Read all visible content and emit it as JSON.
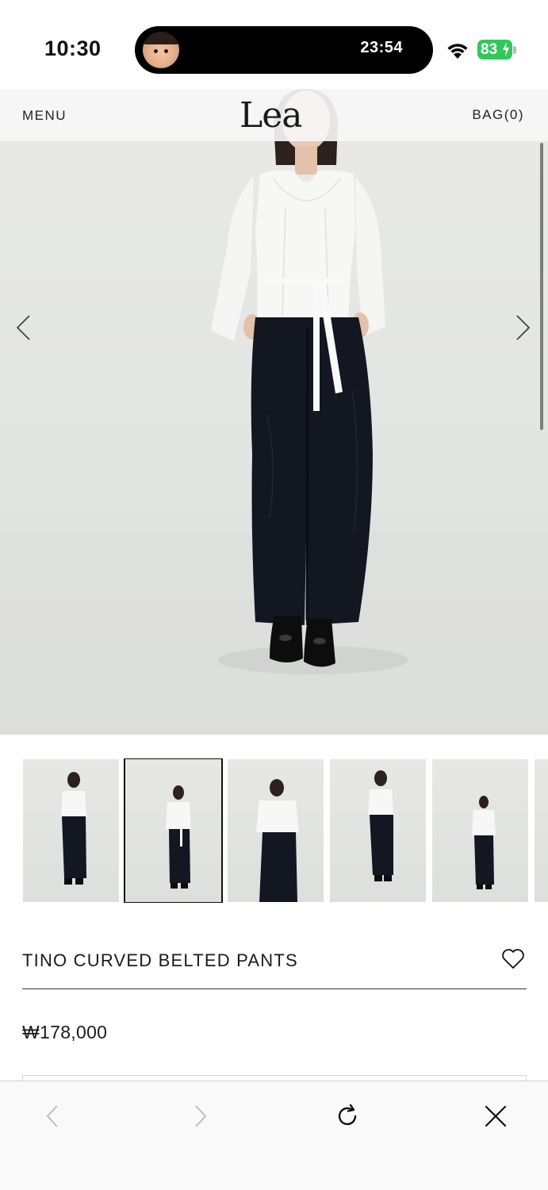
{
  "status_bar": {
    "time": "10:30",
    "live_activity_timer": "23:54",
    "battery_level": "83",
    "battery_color": "#33c759"
  },
  "header": {
    "menu_label": "MENU",
    "brand": "Lea",
    "bag_label": "BAG(0)"
  },
  "gallery": {
    "thumbnail_count": 6,
    "selected_index": 1,
    "prev_icon": "chevron-left-icon",
    "next_icon": "chevron-right-icon"
  },
  "product": {
    "name": "TINO CURVED BELTED PANTS",
    "price": "₩178,000",
    "wishlist_icon": "heart-outline-icon"
  },
  "toolbar": {
    "back_icon": "chevron-left-icon",
    "forward_icon": "chevron-right-icon",
    "reload_icon": "reload-icon",
    "close_icon": "close-icon"
  },
  "colors": {
    "text": "#111111",
    "photo_background": "#e5e6e4",
    "pants": "#121722",
    "blouse": "#f7f7f5"
  }
}
